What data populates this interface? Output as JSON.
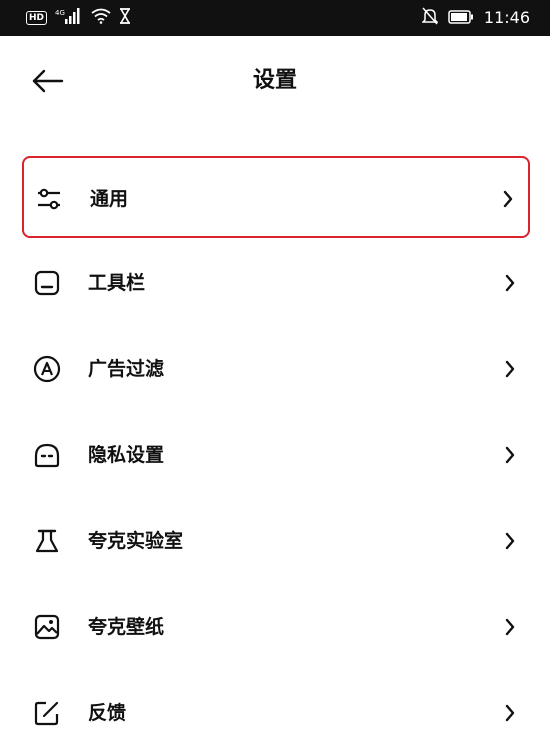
{
  "status_bar": {
    "hd_badge": "HD",
    "network": "4G",
    "time": "11:46",
    "icons": [
      "hd-icon",
      "signal-icon",
      "wifi-icon",
      "hourglass-icon",
      "mute-icon",
      "battery-icon"
    ]
  },
  "header": {
    "title": "设置",
    "back_icon": "arrow-left-icon"
  },
  "settings": {
    "items": [
      {
        "label": "通用",
        "icon": "sliders-icon",
        "selected": true
      },
      {
        "label": "工具栏",
        "icon": "toolbar-icon"
      },
      {
        "label": "广告过滤",
        "icon": "ad-filter-icon"
      },
      {
        "label": "隐私设置",
        "icon": "privacy-icon"
      },
      {
        "label": "夸克实验室",
        "icon": "flask-icon"
      },
      {
        "label": "夸克壁纸",
        "icon": "wallpaper-icon"
      },
      {
        "label": "反馈",
        "icon": "feedback-icon"
      }
    ]
  },
  "colors": {
    "accent_border": "#d9232e",
    "status_bar_bg": "#111111",
    "text": "#111111"
  }
}
